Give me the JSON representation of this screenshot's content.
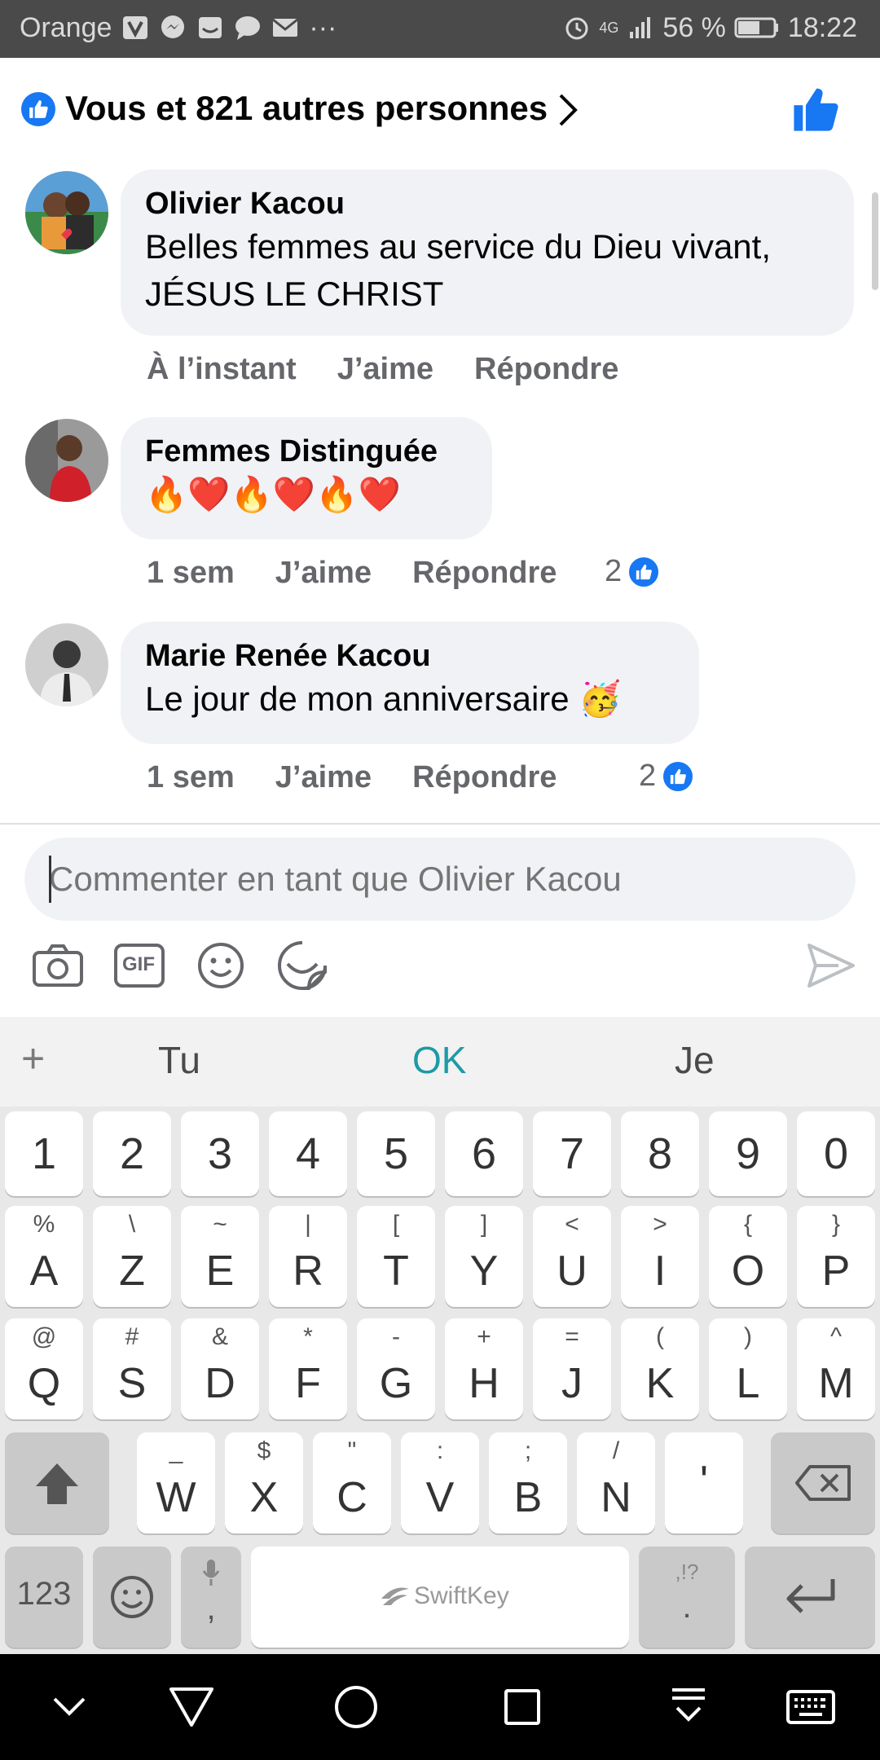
{
  "status_bar": {
    "carrier": "Orange",
    "dots": "···",
    "network": "4G",
    "battery": "56 %",
    "time": "18:22"
  },
  "likes_header": {
    "text": "Vous et 821 autres personnes"
  },
  "comments": [
    {
      "author": "Olivier Kacou",
      "text": "Belles femmes au service du Dieu vivant, JÉSUS LE CHRIST",
      "time": "À l’instant",
      "like_label": "J’aime",
      "reply_label": "Répondre"
    },
    {
      "author": "Femmes Distinguée",
      "text": "🔥❤️🔥❤️🔥❤️",
      "time": "1 sem",
      "like_label": "J’aime",
      "reply_label": "Répondre",
      "reactions": "2"
    },
    {
      "author": "Marie Renée Kacou",
      "text": "Le jour de mon anniversaire 🥳",
      "time": "1 sem",
      "like_label": "J’aime",
      "reply_label": "Répondre",
      "reactions": "2"
    }
  ],
  "composer": {
    "placeholder": "Commenter en tant que Olivier Kacou",
    "tools": [
      "camera-icon",
      "gif-icon",
      "emoji-icon",
      "sticker-icon",
      "send-icon"
    ],
    "gif_label": "GIF"
  },
  "keyboard": {
    "suggestions": [
      "Tu",
      "OK",
      "Je"
    ],
    "plus": "+",
    "number_row": [
      "1",
      "2",
      "3",
      "4",
      "5",
      "6",
      "7",
      "8",
      "9",
      "0"
    ],
    "row1": [
      {
        "main": "A",
        "sub": "%"
      },
      {
        "main": "Z",
        "sub": "\\"
      },
      {
        "main": "E",
        "sub": "~"
      },
      {
        "main": "R",
        "sub": "|"
      },
      {
        "main": "T",
        "sub": "["
      },
      {
        "main": "Y",
        "sub": "]"
      },
      {
        "main": "U",
        "sub": "<"
      },
      {
        "main": "I",
        "sub": ">"
      },
      {
        "main": "O",
        "sub": "{"
      },
      {
        "main": "P",
        "sub": "}"
      }
    ],
    "row2": [
      {
        "main": "Q",
        "sub": "@"
      },
      {
        "main": "S",
        "sub": "#"
      },
      {
        "main": "D",
        "sub": "&"
      },
      {
        "main": "F",
        "sub": "*"
      },
      {
        "main": "G",
        "sub": "-"
      },
      {
        "main": "H",
        "sub": "+"
      },
      {
        "main": "J",
        "sub": "="
      },
      {
        "main": "K",
        "sub": "("
      },
      {
        "main": "L",
        "sub": ")"
      },
      {
        "main": "M",
        "sub": "^"
      }
    ],
    "row3": [
      {
        "main": "W",
        "sub": "_"
      },
      {
        "main": "X",
        "sub": "$"
      },
      {
        "main": "C",
        "sub": "\""
      },
      {
        "main": "V",
        "sub": ":"
      },
      {
        "main": "B",
        "sub": ";"
      },
      {
        "main": "N",
        "sub": "/"
      },
      {
        "main": "'",
        "sub": ""
      }
    ],
    "bottom": {
      "num_label": "123",
      "comma": ",",
      "space_label": "SwiftKey",
      "period": ".",
      "period_sub": ",!?"
    }
  },
  "colors": {
    "facebook_blue": "#1877f2",
    "bubble": "#f0f2f5",
    "meta_gray": "#65676b",
    "swiftkey_teal": "#1e9aa6"
  }
}
